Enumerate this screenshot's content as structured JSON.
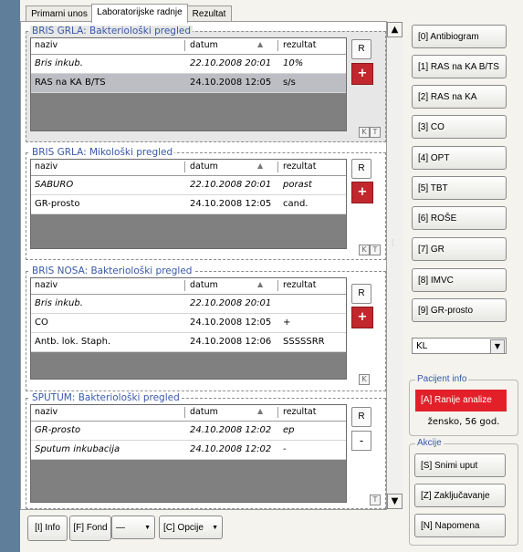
{
  "tabs": [
    "Primarni unos",
    "Laboratorijske radnje",
    "Rezultat"
  ],
  "columns": {
    "naziv": "naziv",
    "datum": "datum",
    "rezultat": "rezultat"
  },
  "panels": [
    {
      "title": "BRIS GRLA: Bakteriološki pregled",
      "rows": [
        {
          "naziv": "Bris inkub.",
          "datum": "22.10.2008 20:01",
          "rezultat": "10%",
          "italic": true
        },
        {
          "naziv": "RAS na KA B/TS",
          "datum": "24.10.2008 12:05",
          "rezultat": "s/s",
          "italic": false
        }
      ],
      "r": "R",
      "plus": "+",
      "k": "K",
      "t": "T"
    },
    {
      "title": "BRIS GRLA: Mikološki pregled",
      "rows": [
        {
          "naziv": "SABURO",
          "datum": "22.10.2008 20:01",
          "rezultat": "porast",
          "italic": true
        },
        {
          "naziv": "GR-prosto",
          "datum": "24.10.2008 12:05",
          "rezultat": "cand.",
          "italic": false
        }
      ],
      "r": "R",
      "plus": "+",
      "k": "K",
      "t": "T"
    },
    {
      "title": "BRIS NOSA: Bakteriološki pregled",
      "rows": [
        {
          "naziv": "Bris inkub.",
          "datum": "22.10.2008 20:01",
          "rezultat": "",
          "italic": true
        },
        {
          "naziv": "CO",
          "datum": "24.10.2008 12:05",
          "rezultat": "+",
          "italic": false
        },
        {
          "naziv": "Antb. lok. Staph.",
          "datum": "24.10.2008 12:06",
          "rezultat": "SSSSSRR",
          "italic": false
        }
      ],
      "r": "R",
      "plus": "+",
      "k": "K"
    },
    {
      "title": "SPUTUM: Bakteriološki pregled",
      "rows": [
        {
          "naziv": "GR-prosto",
          "datum": "24.10.2008 12:02",
          "rezultat": "ep",
          "italic": true
        },
        {
          "naziv": "Sputum inkubacija",
          "datum": "24.10.2008 12:02",
          "rezultat": "-",
          "italic": true
        }
      ],
      "r": "R",
      "minus": "-",
      "t": "T"
    }
  ],
  "analysis_buttons": [
    "[0] Antibiogram",
    "[1] RAS na KA B/TS",
    "[2] RAS na KA",
    "[3] CO",
    "[4] OPT",
    "[5] TBT",
    "[6] ROŠE",
    "[7] GR",
    "[8] IMVC",
    "[9] GR-prosto"
  ],
  "kl_select": "KL",
  "patient_info": {
    "label": "Pacijent info",
    "button": "[A] Ranije analize",
    "text": "žensko, 56 god."
  },
  "actions": {
    "label": "Akcije",
    "buttons": [
      "[S] Snimi uput",
      "[Z] Zaključavanje",
      "[N] Napomena"
    ]
  },
  "bottom": {
    "info": "[I] Info",
    "fond": "[F] Fond",
    "dash": "—",
    "opcije": "[C] Opcije"
  },
  "scroll": {
    "up": "▲",
    "down": "▼"
  }
}
